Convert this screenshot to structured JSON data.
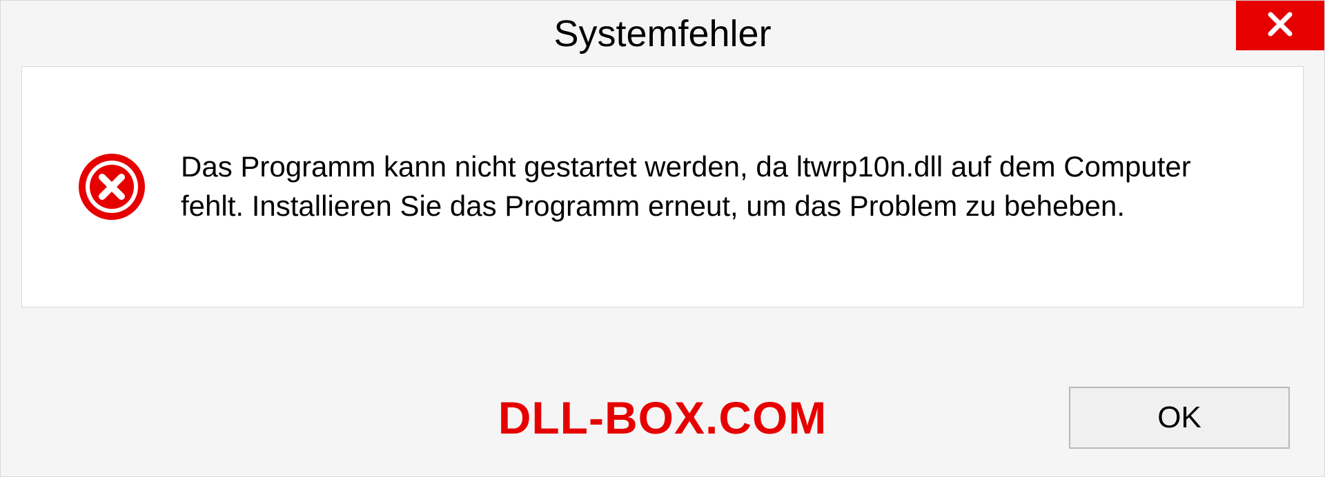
{
  "dialog": {
    "title": "Systemfehler",
    "message": "Das Programm kann nicht gestartet werden, da ltwrp10n.dll auf dem Computer fehlt. Installieren Sie das Programm erneut, um das Problem zu beheben.",
    "ok_label": "OK"
  },
  "watermark": "DLL-BOX.COM"
}
